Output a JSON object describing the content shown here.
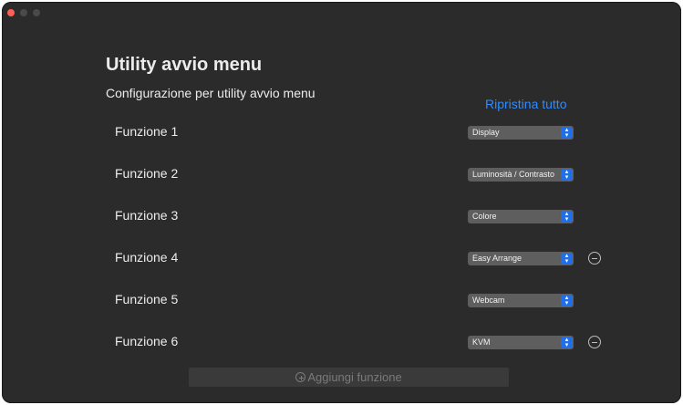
{
  "window": {
    "title": "Utility avvio menu",
    "subtitle": "Configurazione per utility avvio menu",
    "reset_label": "Ripristina tutto"
  },
  "functions": [
    {
      "label": "Funzione 1",
      "value": "Display",
      "removable": false
    },
    {
      "label": "Funzione 2",
      "value": "Luminosità / Contrasto",
      "removable": false
    },
    {
      "label": "Funzione 3",
      "value": "Colore",
      "removable": false
    },
    {
      "label": "Funzione 4",
      "value": "Easy Arrange",
      "removable": true
    },
    {
      "label": "Funzione 5",
      "value": "Webcam",
      "removable": false
    },
    {
      "label": "Funzione 6",
      "value": "KVM",
      "removable": true
    }
  ],
  "add_button": {
    "label": "Aggiungi funzione"
  },
  "colors": {
    "background": "#2b2b2b",
    "accent": "#2f8cff",
    "select_bg": "#5e5e5e",
    "select_arrow": "#1f6feb"
  },
  "icons": {
    "remove": "minus-circle-icon",
    "add": "plus-circle-icon",
    "select": "chevron-updown-icon"
  }
}
